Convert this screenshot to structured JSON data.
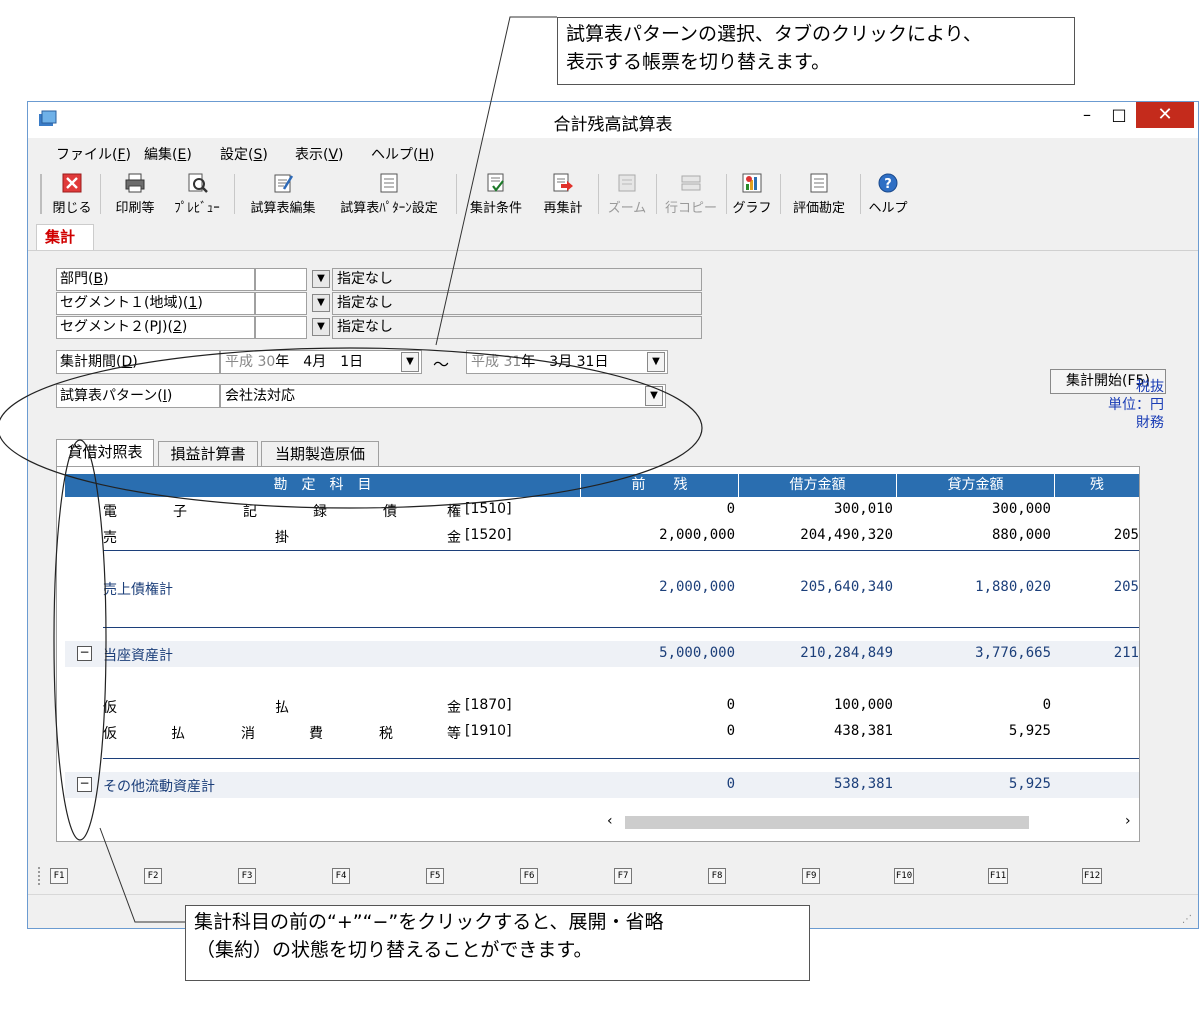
{
  "callouts": {
    "top_line1": "試算表パターンの選択、タブのクリックにより、",
    "top_line2": "表示する帳票を切り替えます。",
    "bottom_line1": "集計科目の前の“+”“−”をクリックすると、展開・省略",
    "bottom_line2": "（集約）の状態を切り替えることができます。"
  },
  "window": {
    "title": "合計残高試算表",
    "min": "–",
    "max": "□",
    "close": "✕"
  },
  "menu": {
    "file": "ファイル(",
    "file_key": "F",
    "file_end": ")",
    "edit": "編集(",
    "edit_key": "E",
    "edit_end": ")",
    "settings": "設定(",
    "settings_key": "S",
    "settings_end": ")",
    "view": "表示(",
    "view_key": "V",
    "view_end": ")",
    "help": "ヘルプ(",
    "help_key": "H",
    "help_end": ")"
  },
  "toolbar": {
    "close": "閉じる",
    "print": "印刷等",
    "preview": "ﾌﾟﾚﾋﾞｭｰ",
    "edit_tb": "試算表編集",
    "pattern_setting": "試算表ﾊﾟﾀｰﾝ設定",
    "condition": "集計条件",
    "recalc": "再集計",
    "zoom": "ズーム",
    "rowcopy": "行コピー",
    "graph": "グラフ",
    "evaluation": "評価勘定",
    "help": "ヘルプ"
  },
  "main_tab": "集計",
  "conditions": {
    "dept_label": "部門(",
    "dept_key": "B",
    "dept_end": ")",
    "dept_value": "指定なし",
    "seg1_label": "セグメント１(地域)(",
    "seg1_key": "1",
    "seg1_end": ")",
    "seg1_value": "指定なし",
    "seg2_label": "セグメント２(PJ)(",
    "seg2_key": "2",
    "seg2_end": ")",
    "seg2_value": "指定なし"
  },
  "start_button": "集計開始(F5)",
  "period": {
    "label": "集計期間(",
    "label_key": "D",
    "label_end": ")",
    "from_era": "平成",
    "from_year": "30",
    "from_rest": "年　4月　1日",
    "tilde": "～",
    "to_era": "平成",
    "to_year": "31",
    "to_rest": "年　3月 31日"
  },
  "pattern": {
    "label": "試算表パターン(",
    "label_key": "I",
    "label_end": ")",
    "value": "会社法対応"
  },
  "tax_info": {
    "line1": "税抜",
    "line2": "単位：円",
    "line3": "財務"
  },
  "sub_tabs": [
    "貸借対照表",
    "損益計算書",
    "当期製造原価"
  ],
  "grid": {
    "headers": [
      "勘　定　科　目",
      "前　　残",
      "借方金額",
      "貸方金額",
      "残"
    ],
    "rows": [
      {
        "chars": [
          "電",
          "子",
          "記",
          "録",
          "債",
          "権"
        ],
        "code": "[1510]",
        "prev": "0",
        "debit": "300,010",
        "credit": "300,000",
        "bal": ""
      },
      {
        "chars": [
          "売",
          "掛",
          "金"
        ],
        "code": "[1520]",
        "prev": "2,000,000",
        "debit": "204,490,320",
        "credit": "880,000",
        "bal": "205"
      },
      {
        "label": "売上債権計",
        "prev": "2,000,000",
        "debit": "205,640,340",
        "credit": "1,880,020",
        "bal": "205"
      },
      {
        "label": "当座資産計",
        "prev": "5,000,000",
        "debit": "210,284,849",
        "credit": "3,776,665",
        "bal": "211"
      },
      {
        "chars": [
          "仮",
          "払",
          "金"
        ],
        "code": "[1870]",
        "prev": "0",
        "debit": "100,000",
        "credit": "0",
        "bal": ""
      },
      {
        "chars": [
          "仮",
          "払",
          "消",
          "費",
          "税",
          "等"
        ],
        "code": "[1910]",
        "prev": "0",
        "debit": "438,381",
        "credit": "5,925",
        "bal": ""
      },
      {
        "label": "その他流動資産計",
        "prev": "0",
        "debit": "538,381",
        "credit": "5,925",
        "bal": ""
      }
    ],
    "collapse_symbol": "−"
  },
  "fkeys": [
    "F1",
    "F2",
    "F3",
    "F4",
    "F5",
    "F6",
    "F7",
    "F8",
    "F9",
    "F10",
    "F11",
    "F12"
  ],
  "colors": {
    "header_blue": "#2a6eb0",
    "total_text": "#1c3f7a",
    "close_red": "#c42b1c",
    "tab_red": "#d00000"
  }
}
